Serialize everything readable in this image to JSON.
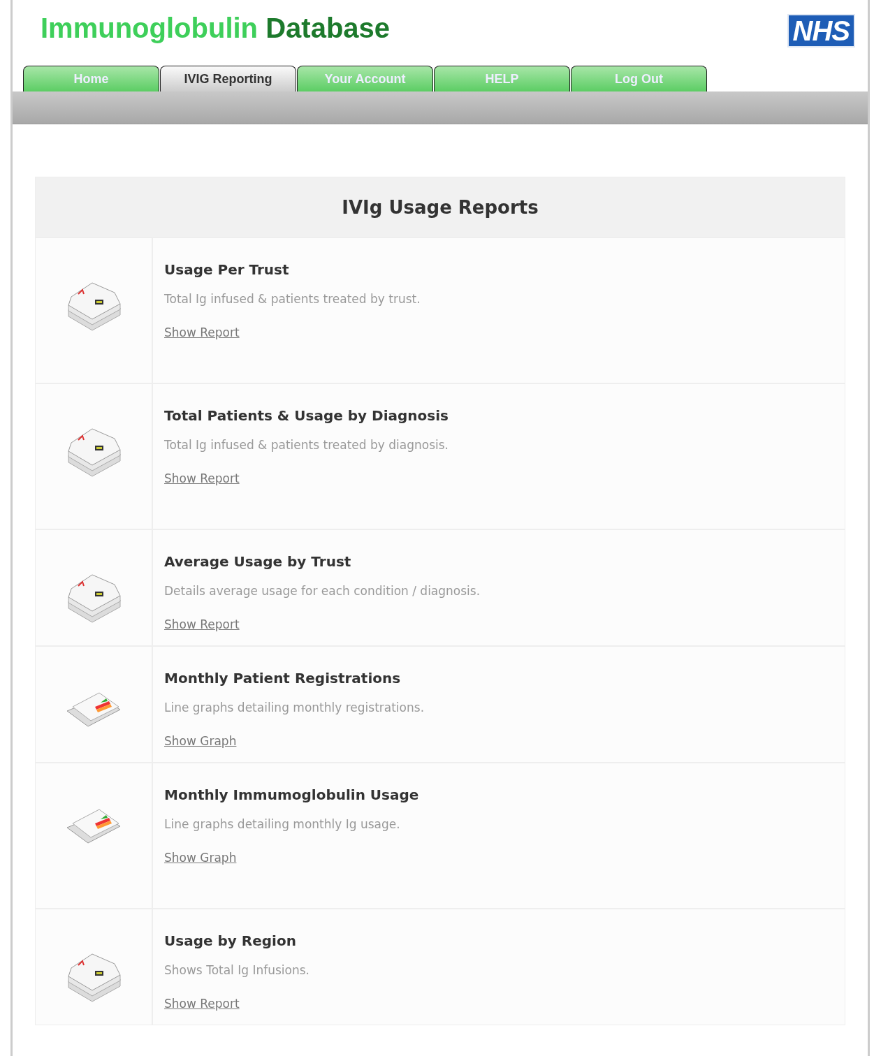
{
  "header": {
    "title_light": "Immunoglobulin",
    "title_dark": "Database",
    "logo": "NHS"
  },
  "tabs": [
    {
      "label": "Home",
      "selected": false
    },
    {
      "label": "IVIG Reporting",
      "selected": true
    },
    {
      "label": "Your Account",
      "selected": false
    },
    {
      "label": "HELP",
      "selected": false
    },
    {
      "label": "Log Out",
      "selected": false
    }
  ],
  "panel": {
    "title": "IVIg Usage Reports"
  },
  "reports": [
    {
      "kind": "report",
      "title": "Usage Per Trust",
      "description": "Total Ig infused & patients treated by trust.",
      "link": "Show Report"
    },
    {
      "kind": "report",
      "title": "Total Patients & Usage by Diagnosis",
      "description": "Total Ig infused & patients treated by diagnosis.",
      "link": "Show Report"
    },
    {
      "kind": "report",
      "title": "Average Usage by Trust",
      "description": "Details average usage for each condition / diagnosis.",
      "link": "Show Report"
    },
    {
      "kind": "graph",
      "title": "Monthly Patient Registrations",
      "description": "Line graphs detailing monthly registrations.",
      "link": "Show Graph"
    },
    {
      "kind": "graph",
      "title": "Monthly Immumoglobulin Usage",
      "description": "Line graphs detailing monthly Ig usage.",
      "link": "Show Graph"
    },
    {
      "kind": "report",
      "title": "Usage by Region",
      "description": "Shows Total Ig Infusions.",
      "link": "Show Report"
    }
  ]
}
